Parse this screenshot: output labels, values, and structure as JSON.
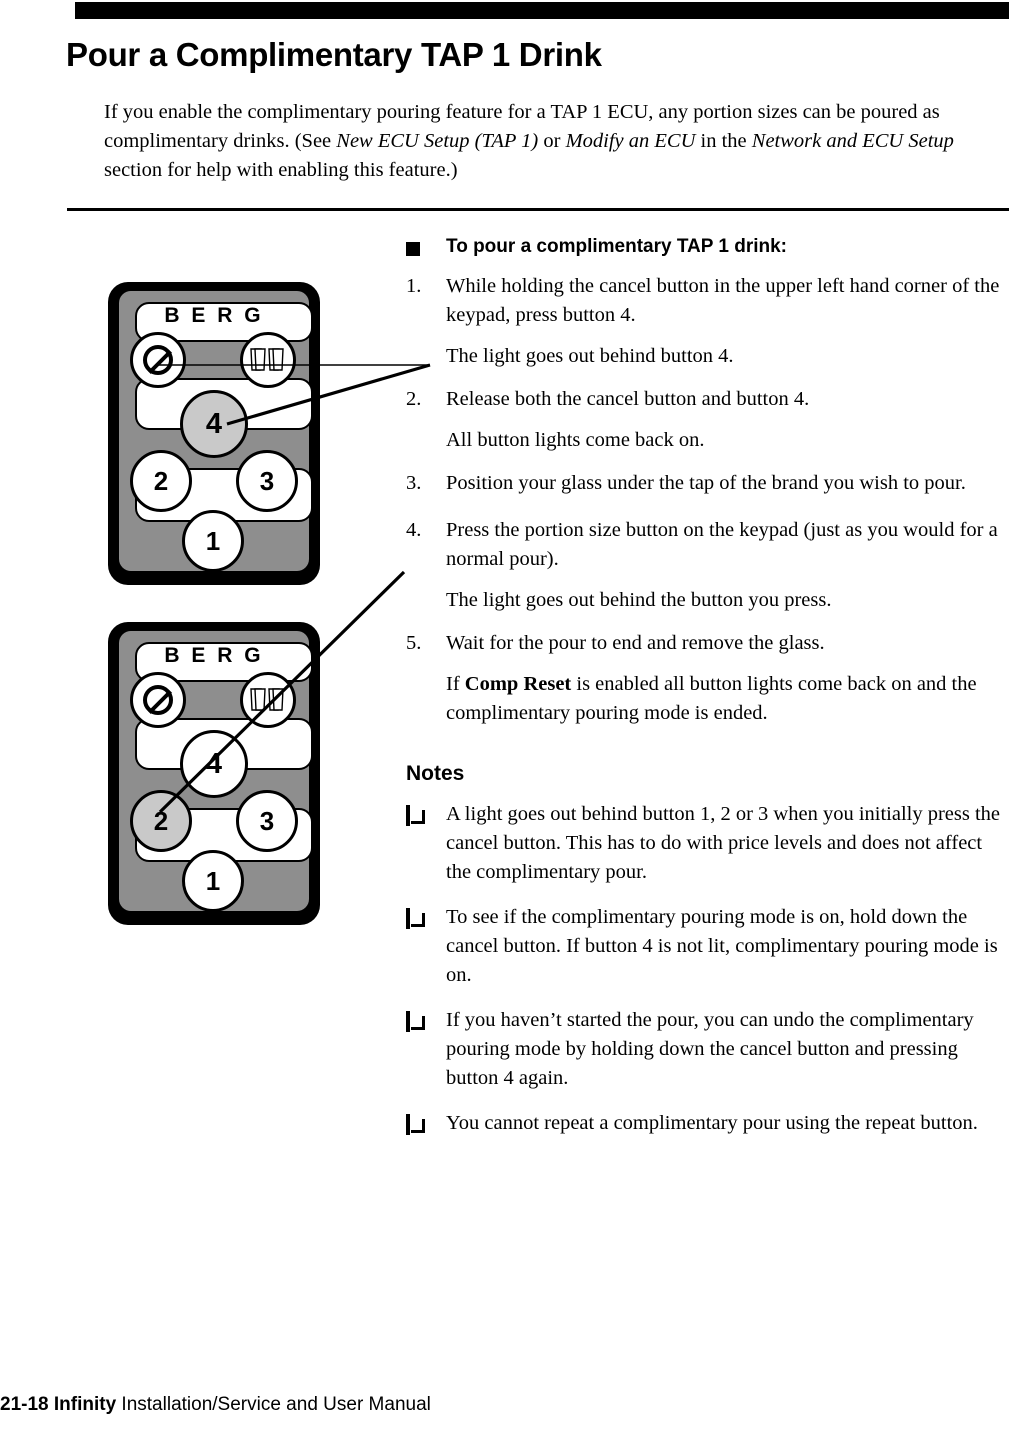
{
  "document": {
    "title": "Pour a Complimentary TAP 1 Drink",
    "intro": {
      "part1": "If you enable the complimentary pouring feature for a TAP 1 ECU, any portion sizes can be poured as complimentary drinks. (See ",
      "ref1": "New ECU Setup (TAP 1)",
      "conj": " or ",
      "ref2": "Modify an ECU",
      "mid": " in the ",
      "ref3": "Network and ECU Setup",
      "part2": " section for help with enabling this feature.)"
    }
  },
  "procedure": {
    "heading": "To pour a complimentary TAP 1 drink:",
    "steps": [
      {
        "num": "1.",
        "text": "While holding the cancel button in the upper left hand corner of the keypad, press button 4.",
        "result": "The light goes out behind button 4."
      },
      {
        "num": "2.",
        "text": "Release both the cancel button and button 4.",
        "result": "All button lights come back on."
      },
      {
        "num": "3.",
        "text": "Position your glass under the tap of the brand you wish to pour.",
        "result": ""
      },
      {
        "num": "4.",
        "text": "Press the portion size button on the keypad (just as you would for a normal pour).",
        "result": "The light goes out behind the button you press."
      },
      {
        "num": "5.",
        "text": "Wait for the pour to end and remove the glass.",
        "result_pre": "If ",
        "result_bold": "Comp Reset",
        "result_post": " is enabled all button lights come back on and the complimentary pouring mode is ended."
      }
    ]
  },
  "notes": {
    "heading": "Notes",
    "items": [
      "A light goes out behind button 1, 2 or 3 when you initially press the cancel button. This has to do with price levels and does not affect the complimentary pour.",
      "To see if the complimentary pouring mode is on, hold down the cancel button. If button 4 is not lit, complimentary pouring mode is on.",
      "If you haven’t started the pour, you can undo the complimentary pouring mode by holding down the cancel button and pressing button 4 again.",
      "You cannot repeat a complimentary pour using the repeat button."
    ]
  },
  "keypads": [
    {
      "id": "keypad-step1",
      "brand": "B E R G",
      "keys": {
        "cancel": "",
        "repeat": "",
        "k4": "4",
        "k2": "2",
        "k3": "3",
        "k1": "1"
      },
      "highlighted_key": "4"
    },
    {
      "id": "keypad-step4",
      "brand": "B E R G",
      "keys": {
        "cancel": "",
        "repeat": "",
        "k4": "4",
        "k2": "2",
        "k3": "3",
        "k1": "1"
      },
      "highlighted_key": "2"
    }
  ],
  "footer": {
    "page": "21-18 Infinity",
    "manual": " Installation/Service and User Manual"
  },
  "colors": {
    "ink": "#000000",
    "keypad_face": "#8e8e8e",
    "key_shaded": "#c9c9c9",
    "paper": "#ffffff"
  }
}
